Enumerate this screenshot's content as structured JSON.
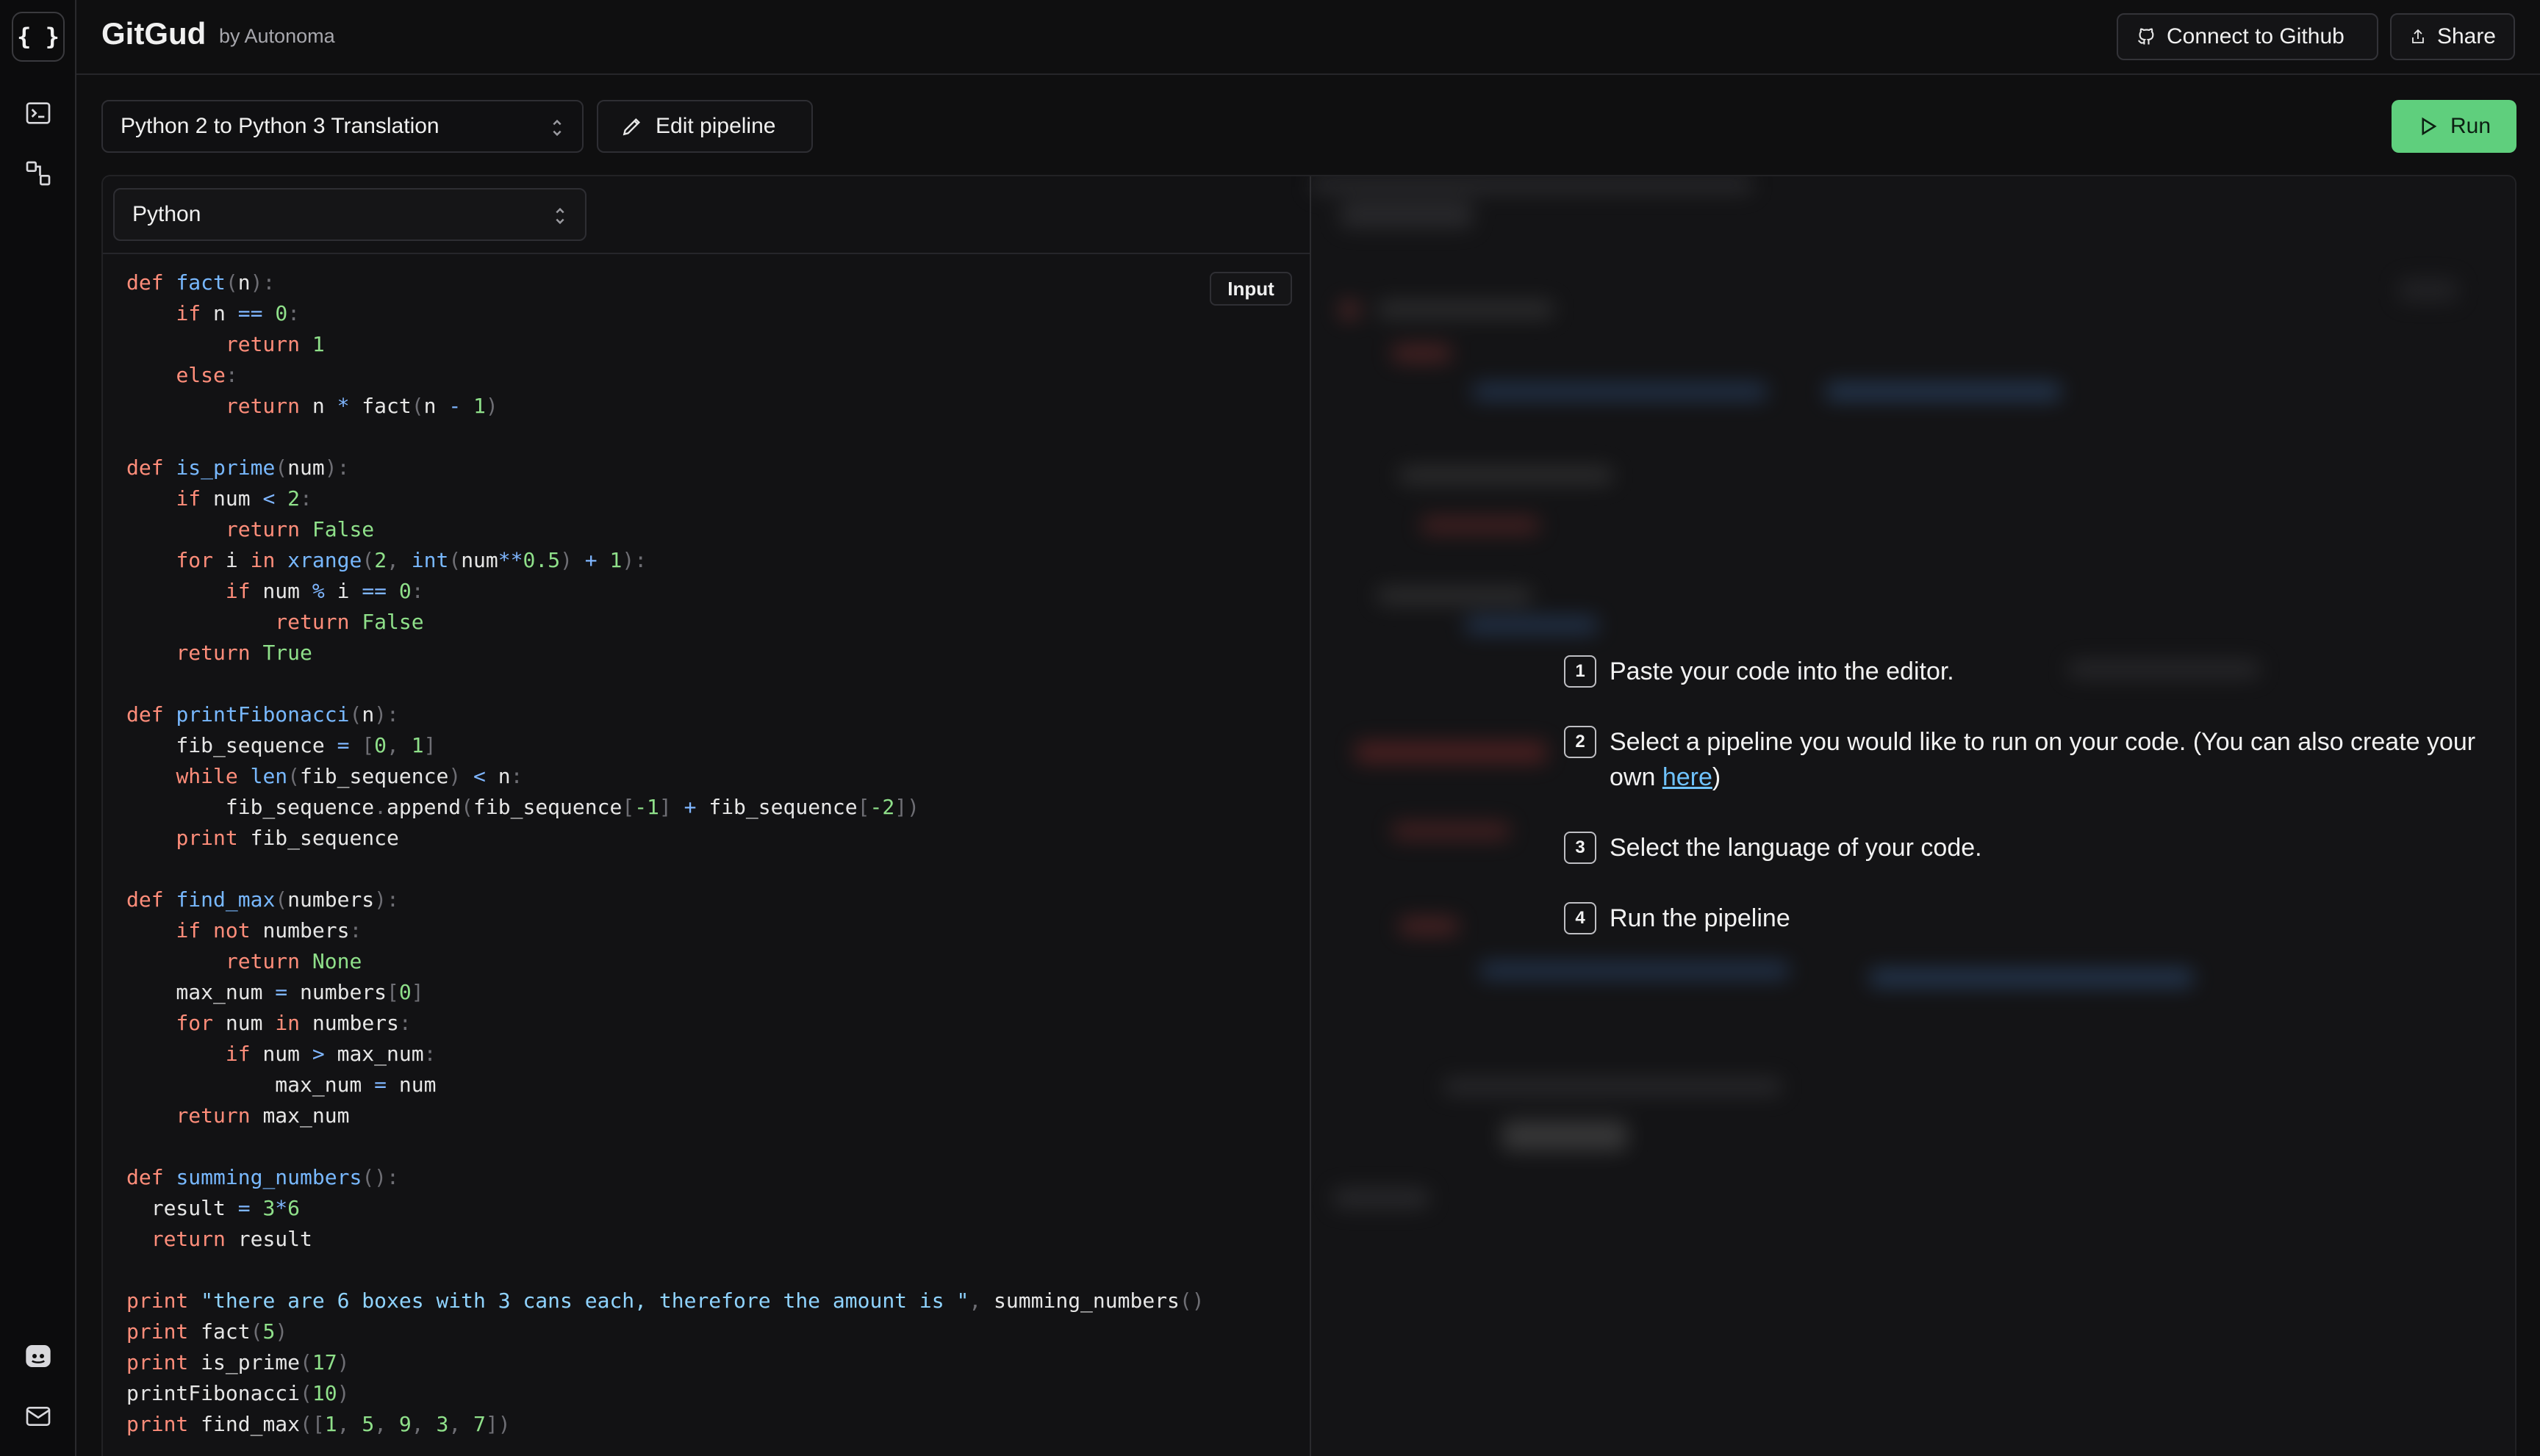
{
  "app": {
    "name": "GitGud",
    "byline": "by Autonoma",
    "logo_glyph": "{ }"
  },
  "header": {
    "connect_label": "Connect to Github",
    "share_label": "Share"
  },
  "toolbar": {
    "pipeline_select": "Python 2 to Python 3 Translation",
    "edit_label": "Edit pipeline",
    "run_label": "Run"
  },
  "editor": {
    "language_select": "Python",
    "badge_label": "Input"
  },
  "instructions": {
    "step1": {
      "num": "1",
      "text": "Paste your code into the editor."
    },
    "step2": {
      "num": "2",
      "text_before": "Select a pipeline you would like to run on your code. (You can also create your own ",
      "link": "here",
      "text_after": ")"
    },
    "step3": {
      "num": "3",
      "text": "Select the language of your code."
    },
    "step4": {
      "num": "4",
      "text": "Run the pipeline"
    }
  },
  "colors": {
    "accent_run": "#5fcf7d",
    "keyword": "#ff8d7a",
    "function": "#78b8ff",
    "number": "#8fe08a",
    "string": "#8fd3ff",
    "link": "#6fc3ff"
  }
}
